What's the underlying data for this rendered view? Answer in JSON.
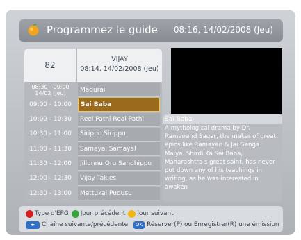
{
  "header": {
    "title": "Programmez le guide",
    "datetime": "08:16, 14/02/2008 (Jeu)"
  },
  "channel": {
    "number": "82",
    "name": "VIJAY",
    "datetime": "08:14, 14/02/2008 (Jeu)"
  },
  "schedule": [
    {
      "time": "08:30 - 09:00 14/02 (Jeu)",
      "program": "Madurai",
      "selected": false
    },
    {
      "time": "09:00 - 10:00",
      "program": "Sai Baba",
      "selected": true
    },
    {
      "time": "10:00 - 10:30",
      "program": "Reel Pathi Real Pathi",
      "selected": false
    },
    {
      "time": "10:30 - 11:00",
      "program": "Sirippo Sirippu",
      "selected": false
    },
    {
      "time": "11:00 - 11:30",
      "program": "Samayal Samayal",
      "selected": false
    },
    {
      "time": "11:30 - 12:00",
      "program": "Jillunnu Oru Sandhippu",
      "selected": false
    },
    {
      "time": "12:00 - 12:30",
      "program": "Vijay Takies",
      "selected": false
    },
    {
      "time": "12:30 - 13:00",
      "program": "Mettukal Pudusu",
      "selected": false
    }
  ],
  "description": {
    "title": "Sai Baba",
    "text": "A mythological drama by Dr. Ramanand Sagar, the maker of great epics like Ramayan & Jai Ganga Maiya. Shirdi Ka Sai Baba, Maharashtra s great saint, has never put down any of his teachings in writing, as he was interested in awaken"
  },
  "footer": {
    "red_label": "Type d'EPG",
    "green_label": "Jour précédent",
    "yellow_label": "Jour suivant",
    "nav_label": "Chaîne suivante/précédente",
    "ok_key": "OK",
    "ok_label": "Réserver(P) ou Enregistrer(R) une émission"
  },
  "colors": {
    "red": "#d62020",
    "green": "#35a43a",
    "yellow": "#f0b713",
    "selection": "#9b6a1a"
  }
}
